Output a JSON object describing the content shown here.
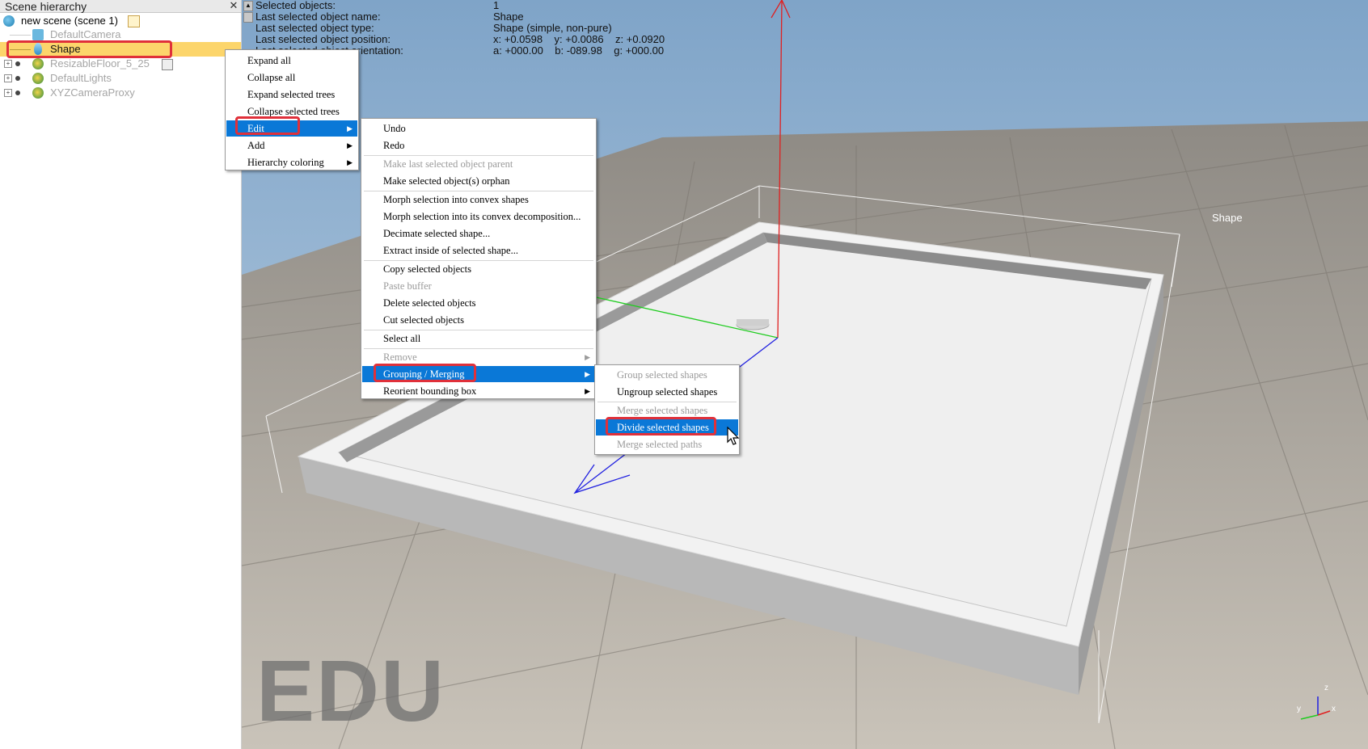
{
  "hierarchy": {
    "title": "Scene hierarchy",
    "close": "✕",
    "scene_label": "new scene (scene 1)",
    "items": [
      {
        "label": "DefaultCamera"
      },
      {
        "label": "Shape"
      },
      {
        "label": "ResizableFloor_5_25"
      },
      {
        "label": "DefaultLights"
      },
      {
        "label": "XYZCameraProxy"
      }
    ]
  },
  "info": {
    "rows": [
      {
        "key": "Selected objects:",
        "value": "1"
      },
      {
        "key": "Last selected object name:",
        "value": "Shape"
      },
      {
        "key": "Last selected object type:",
        "value": "Shape (simple, non-pure)"
      },
      {
        "key": "Last selected object position:",
        "value": "x: +0.0598    y: +0.0086    z: +0.0920"
      },
      {
        "key": "Last selected object orientation:",
        "value": "a: +000.00    b: -089.98    g: +000.00"
      }
    ]
  },
  "context_menu": {
    "items": [
      {
        "label": "Expand all"
      },
      {
        "label": "Collapse all"
      },
      {
        "label": "Expand selected trees"
      },
      {
        "label": "Collapse selected trees"
      },
      {
        "label": "Edit"
      },
      {
        "label": "Add"
      },
      {
        "label": "Hierarchy coloring"
      }
    ]
  },
  "edit_menu": {
    "items": [
      {
        "label": "Undo"
      },
      {
        "label": "Redo"
      },
      {
        "label": "Make last selected object parent"
      },
      {
        "label": "Make selected object(s) orphan"
      },
      {
        "label": "Morph selection into convex shapes"
      },
      {
        "label": "Morph selection into its convex decomposition..."
      },
      {
        "label": "Decimate selected shape..."
      },
      {
        "label": "Extract inside of selected shape..."
      },
      {
        "label": "Copy selected objects"
      },
      {
        "label": "Paste buffer"
      },
      {
        "label": "Delete selected objects"
      },
      {
        "label": "Cut selected objects"
      },
      {
        "label": "Select all"
      },
      {
        "label": "Remove"
      },
      {
        "label": "Grouping / Merging"
      },
      {
        "label": "Reorient bounding box"
      }
    ]
  },
  "grouping_menu": {
    "items": [
      {
        "label": "Group selected shapes"
      },
      {
        "label": "Ungroup selected shapes"
      },
      {
        "label": "Merge selected shapes"
      },
      {
        "label": "Divide selected shapes"
      },
      {
        "label": "Merge selected paths"
      }
    ]
  },
  "viewport": {
    "watermark": "EDU",
    "object_label": "Shape",
    "axis_z": "z",
    "axis_x": "x",
    "axis_y": "y"
  },
  "colors": {
    "highlight": "#0a78d7",
    "selection_row": "#fcd56b",
    "annotation_red": "#e0303a"
  },
  "icons": [
    "scene-globe-icon",
    "camera-icon",
    "shape-icon",
    "floor-icon",
    "lights-icon",
    "camera-proxy-icon",
    "submenu-arrow-icon",
    "mouse-cursor-icon"
  ]
}
